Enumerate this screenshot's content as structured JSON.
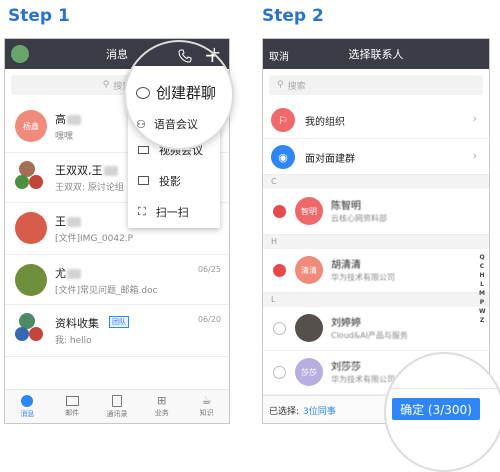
{
  "steps": {
    "step1": "Step 1",
    "step2": "Step 2"
  },
  "p1": {
    "title": "消息",
    "search": "搜索",
    "conversations": [
      {
        "avatar_text": "杨鑫",
        "name": "高",
        "preview": "嘿嘿",
        "date": "",
        "badge": ""
      },
      {
        "avatar_text": "",
        "name": "王双双,王",
        "preview": "王双双: 原讨论组",
        "date": "",
        "badge": ""
      },
      {
        "avatar_text": "",
        "name": "王",
        "preview": "[文件]IMG_0042.P",
        "date": "",
        "badge": ""
      },
      {
        "avatar_text": "",
        "name": "尤",
        "preview": "[文件]常见问题_邮箱.doc",
        "date": "06/25",
        "badge": ""
      },
      {
        "avatar_text": "",
        "name": "资料收集",
        "preview": "我: hello",
        "date": "06/20",
        "badge": "团队"
      }
    ],
    "menu": [
      "创建群聊",
      "语音会议",
      "视频会议",
      "投影",
      "扫一扫"
    ],
    "tabs": [
      "消息",
      "邮件",
      "通讯录",
      "业务",
      "知识"
    ]
  },
  "p2": {
    "cancel": "取消",
    "title": "选择联系人",
    "search": "搜索",
    "org": "我的组织",
    "face": "面对面建群",
    "sections": [
      "C",
      "H",
      "L"
    ],
    "contacts": [
      {
        "avatar_text": "智明",
        "name": "陈智明",
        "sub": "云核心网资料部",
        "checked": true
      },
      {
        "avatar_text": "清清",
        "name": "胡清清",
        "sub": "华为技术有限公司",
        "checked": true
      },
      {
        "avatar_text": "",
        "name": "刘婷婷",
        "sub": "Cloud&AI产品与服务",
        "checked": false
      },
      {
        "avatar_text": "莎莎",
        "name": "刘莎莎",
        "sub": "华为技术有限公司",
        "checked": false
      }
    ],
    "index_letters": [
      "Q",
      "C",
      "H",
      "L",
      "M",
      "P",
      "W",
      "Z"
    ],
    "selected_label": "已选择:",
    "selected_link": "3位同事",
    "confirm": "确定 (3/300)"
  }
}
